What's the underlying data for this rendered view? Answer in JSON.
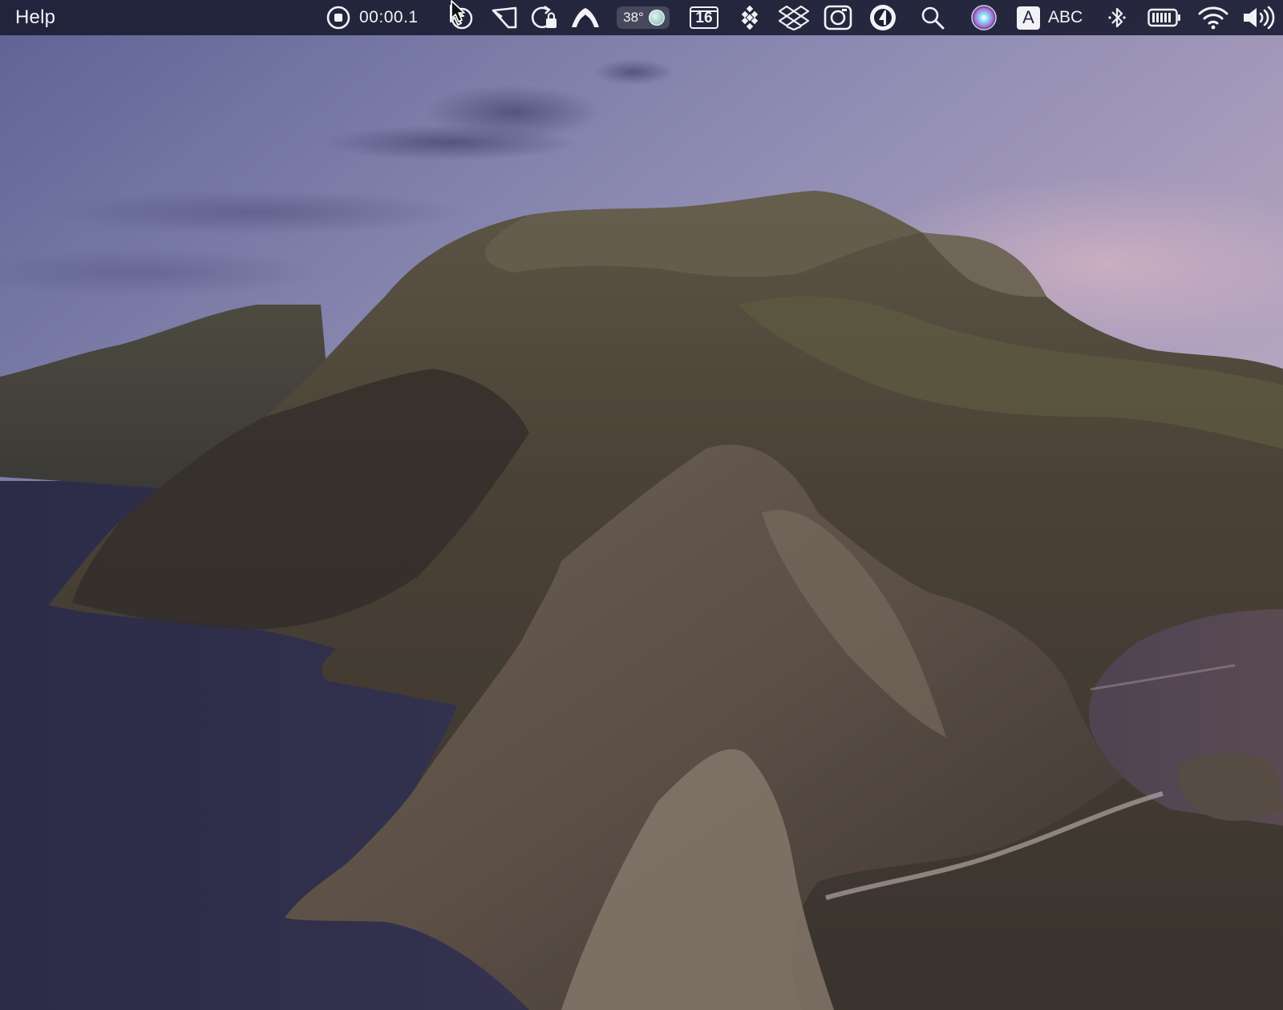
{
  "menubar": {
    "app_menu": "Help",
    "recording_timer": "00:00.1",
    "weather_temp": "38°",
    "calendar_day": "16",
    "input_source_letter": "A",
    "input_source_name": "ABC"
  },
  "icons": [
    "stop-record-icon",
    "cursor-app-icon",
    "mirror-icon",
    "lock-refresh-icon",
    "mountain-app-icon",
    "moon-icon",
    "calendar-icon",
    "dotted-grid-icon",
    "dropbox-icon",
    "screenshot-icon",
    "one-password-icon",
    "spotlight-search-icon",
    "siri-icon",
    "bluetooth-icon",
    "battery-icon",
    "wifi-icon",
    "volume-icon"
  ],
  "colors": {
    "menubar_bg": "#1c1e34",
    "menubar_text": "#f2f2f6"
  }
}
